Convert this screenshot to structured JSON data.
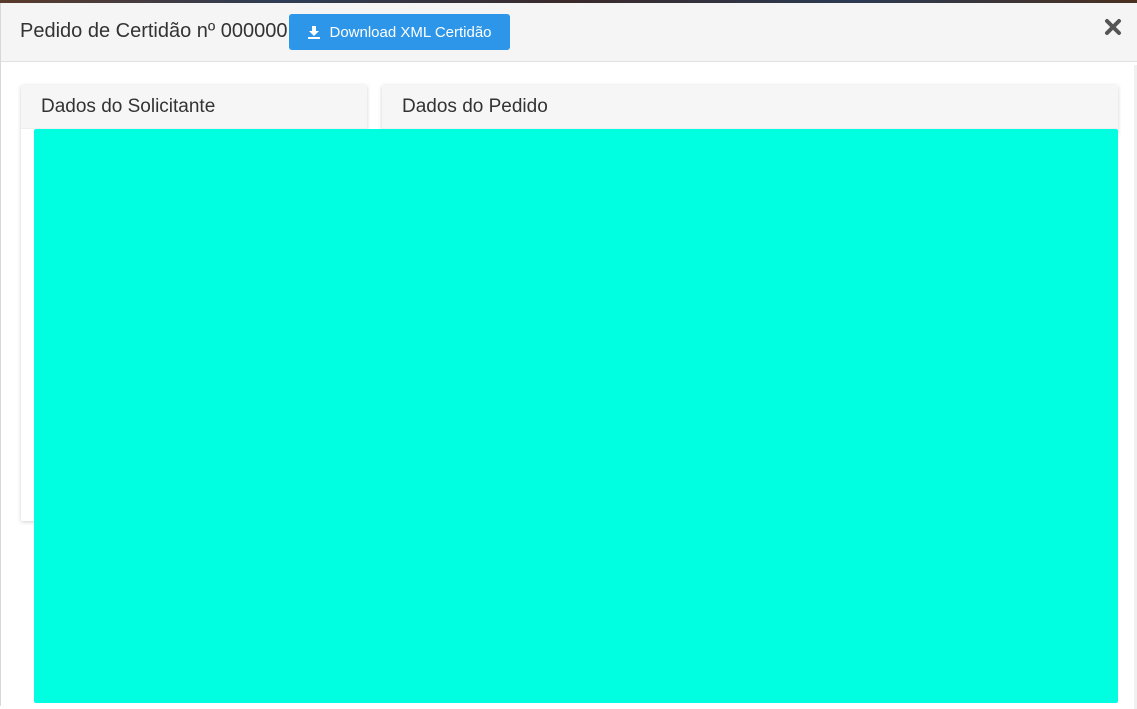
{
  "modal": {
    "title": "Pedido de Certidão nº 000000",
    "download_button_label": "Download XML Certidão",
    "download_icon": "download-icon",
    "close_icon": "close-icon"
  },
  "panels": {
    "solicitante_title": "Dados do Solicitante",
    "pedido_title": "Dados do Pedido"
  },
  "colors": {
    "accent": "#2d96e8",
    "redaction": "#00ffe1",
    "header_bg": "#f5f5f5"
  }
}
